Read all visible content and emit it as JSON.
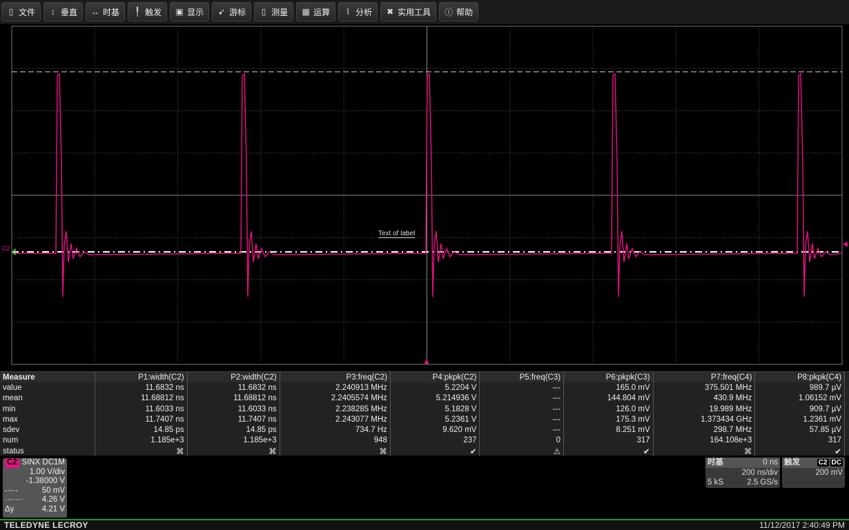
{
  "menu": [
    {
      "icon": "clipboard-icon",
      "label": "文件"
    },
    {
      "icon": "vertical-arrows-icon",
      "label": "垂直"
    },
    {
      "icon": "horizontal-arrows-icon",
      "label": "时基"
    },
    {
      "icon": "trigger-icon",
      "label": "触发"
    },
    {
      "icon": "display-icon",
      "label": "显示"
    },
    {
      "icon": "cursor-icon",
      "label": "游标"
    },
    {
      "icon": "measure-icon",
      "label": "测量"
    },
    {
      "icon": "calculator-icon",
      "label": "运算"
    },
    {
      "icon": "analysis-icon",
      "label": "分析"
    },
    {
      "icon": "tools-icon",
      "label": "实用工具"
    },
    {
      "icon": "info-icon",
      "label": "帮助"
    }
  ],
  "scope": {
    "channel_marker": "C2",
    "label_text": "Text of label",
    "trace_color": "#e0107f",
    "grid": {
      "h_divs": 10,
      "v_divs": 8
    }
  },
  "measure": {
    "header": [
      "Measure",
      "P1:width(C2)",
      "P2:width(C2)",
      "P3:freq(C2)",
      "P4:pkpk(C2)",
      "P5:freq(C3)",
      "P6:pkpk(C3)",
      "P7:freq(C4)",
      "P8:pkpk(C4)"
    ],
    "rows": [
      [
        "value",
        "11.6832 ns",
        "11.6832 ns",
        "2.240913 MHz",
        "5.2204 V",
        "---",
        "165.0 mV",
        "375.501 MHz",
        "989.7 µV"
      ],
      [
        "mean",
        "11.68812 ns",
        "11.68812 ns",
        "2.2405574 MHz",
        "5.214936 V",
        "---",
        "144.804 mV",
        "430.9 MHz",
        "1.06152 mV"
      ],
      [
        "min",
        "11.6033 ns",
        "11.6033 ns",
        "2.238285 MHz",
        "5.1828 V",
        "---",
        "126.0 mV",
        "19.989 MHz",
        "909.7 µV"
      ],
      [
        "max",
        "11.7407 ns",
        "11.7407 ns",
        "2.243077 MHz",
        "5.2361 V",
        "---",
        "175.3 mV",
        "1.373434 GHz",
        "1.2361 mV"
      ],
      [
        "sdev",
        "14.85 ps",
        "14.85 ps",
        "734.7 Hz",
        "9.620 mV",
        "---",
        "8.251 mV",
        "298.7 MHz",
        "57.85 µV"
      ],
      [
        "num",
        "1.185e+3",
        "1.185e+3",
        "948",
        "237",
        "0",
        "317",
        "164.108e+3",
        "317"
      ]
    ],
    "status_label": "status",
    "status": [
      "x",
      "x",
      "x",
      "ok",
      "warn",
      "ok",
      "x",
      "ok"
    ]
  },
  "channel": {
    "name": "C2",
    "coupling": "SINX DC1M",
    "vdiv": "1.00 V/div",
    "offset": "-1.38000 V",
    "dashdot_label": "-·-·-",
    "dashdot_value": "50 mV",
    "dotted_label": "·······",
    "dotted_value": "4.26 V",
    "dy_label": "Δy",
    "dy_value": "4.21 V"
  },
  "timebase": {
    "title": "时基",
    "delay": "0 ns",
    "tdiv": "200 ns/div",
    "samples": "5 kS",
    "rate": "2.5 GS/s"
  },
  "trigger": {
    "title": "触发",
    "source": "C2",
    "coupling": "DC",
    "level": "200 mV"
  },
  "footer": {
    "brand": "TELEDYNE LECROY",
    "datetime": "11/12/2017 2:40:49 PM"
  }
}
